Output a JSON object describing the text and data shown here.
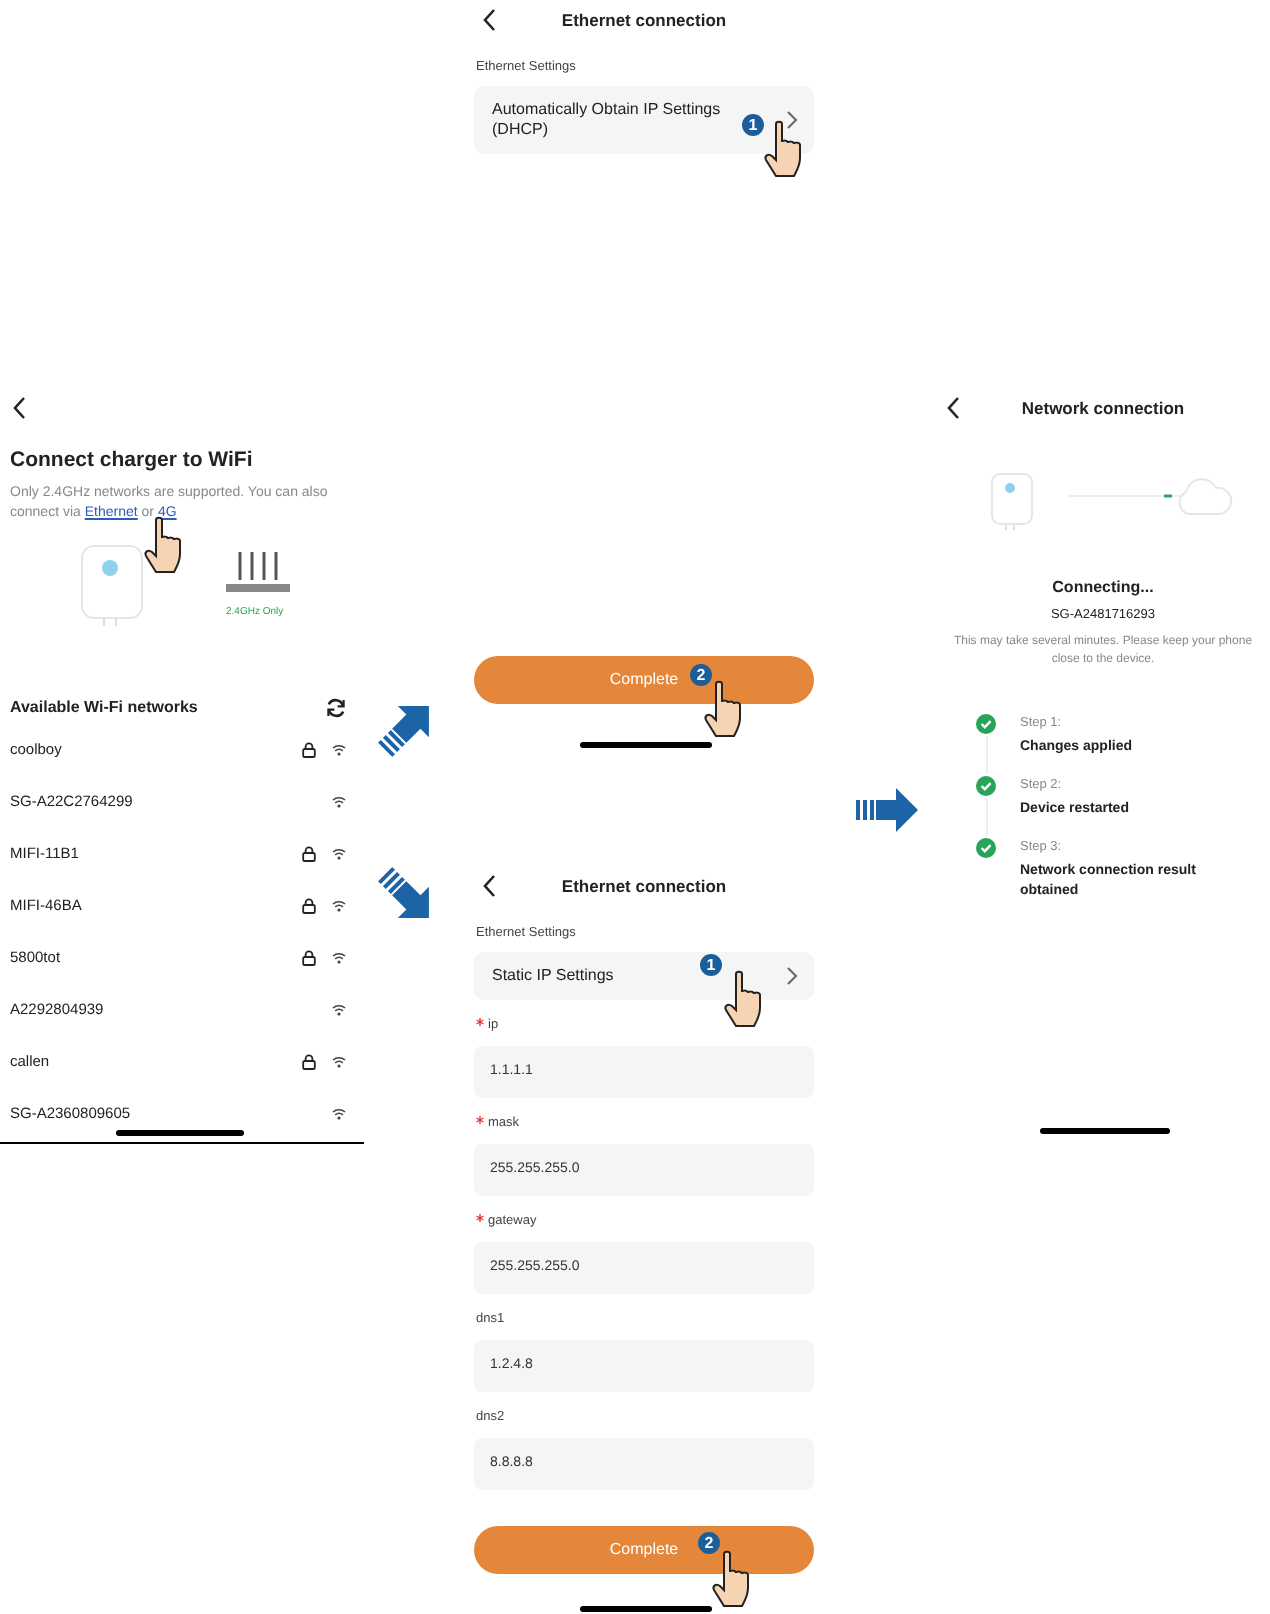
{
  "wifi_screen": {
    "title": "Connect charger to WiFi",
    "description": "Only 2.4GHz networks are supported. You can also connect via",
    "links": [
      "Ethernet",
      "4G"
    ],
    "link_separator": "or",
    "router_label": "2.4GHz Only",
    "networks_heading": "Available Wi-Fi networks",
    "networks": [
      {
        "name": "coolboy",
        "locked": true
      },
      {
        "name": "SG-A22C2764299",
        "locked": false
      },
      {
        "name": "MIFI-11B1",
        "locked": true
      },
      {
        "name": "MIFI-46BA",
        "locked": true
      },
      {
        "name": "5800tot",
        "locked": true
      },
      {
        "name": "A2292804939",
        "locked": false
      },
      {
        "name": "callen",
        "locked": true
      },
      {
        "name": "SG-A2360809605",
        "locked": false
      }
    ]
  },
  "dhcp_screen": {
    "title": "Ethernet connection",
    "section_label": "Ethernet Settings",
    "mode": "Automatically Obtain IP Settings (DHCP)",
    "mode_badge": "1",
    "button": "Complete",
    "button_badge": "2"
  },
  "static_screen": {
    "title": "Ethernet connection",
    "section_label": "Ethernet Settings",
    "mode": "Static IP Settings",
    "mode_badge": "1",
    "fields": [
      {
        "label": "ip",
        "required": true,
        "value": "1.1.1.1"
      },
      {
        "label": "mask",
        "required": true,
        "value": "255.255.255.0"
      },
      {
        "label": "gateway",
        "required": true,
        "value": "255.255.255.0"
      },
      {
        "label": "dns1",
        "required": false,
        "value": "1.2.4.8"
      },
      {
        "label": "dns2",
        "required": false,
        "value": "8.8.8.8"
      }
    ],
    "button": "Complete",
    "button_badge": "2"
  },
  "connecting_screen": {
    "title": "Network connection",
    "status": "Connecting...",
    "device_id": "SG-A2481716293",
    "hint": "This may take several minutes. Please keep your phone close to the device.",
    "steps": [
      {
        "label": "Step 1:",
        "text": "Changes applied",
        "done": true
      },
      {
        "label": "Step 2:",
        "text": "Device restarted",
        "done": true
      },
      {
        "label": "Step 3:",
        "text": "Network connection result obtained",
        "done": true
      }
    ]
  }
}
